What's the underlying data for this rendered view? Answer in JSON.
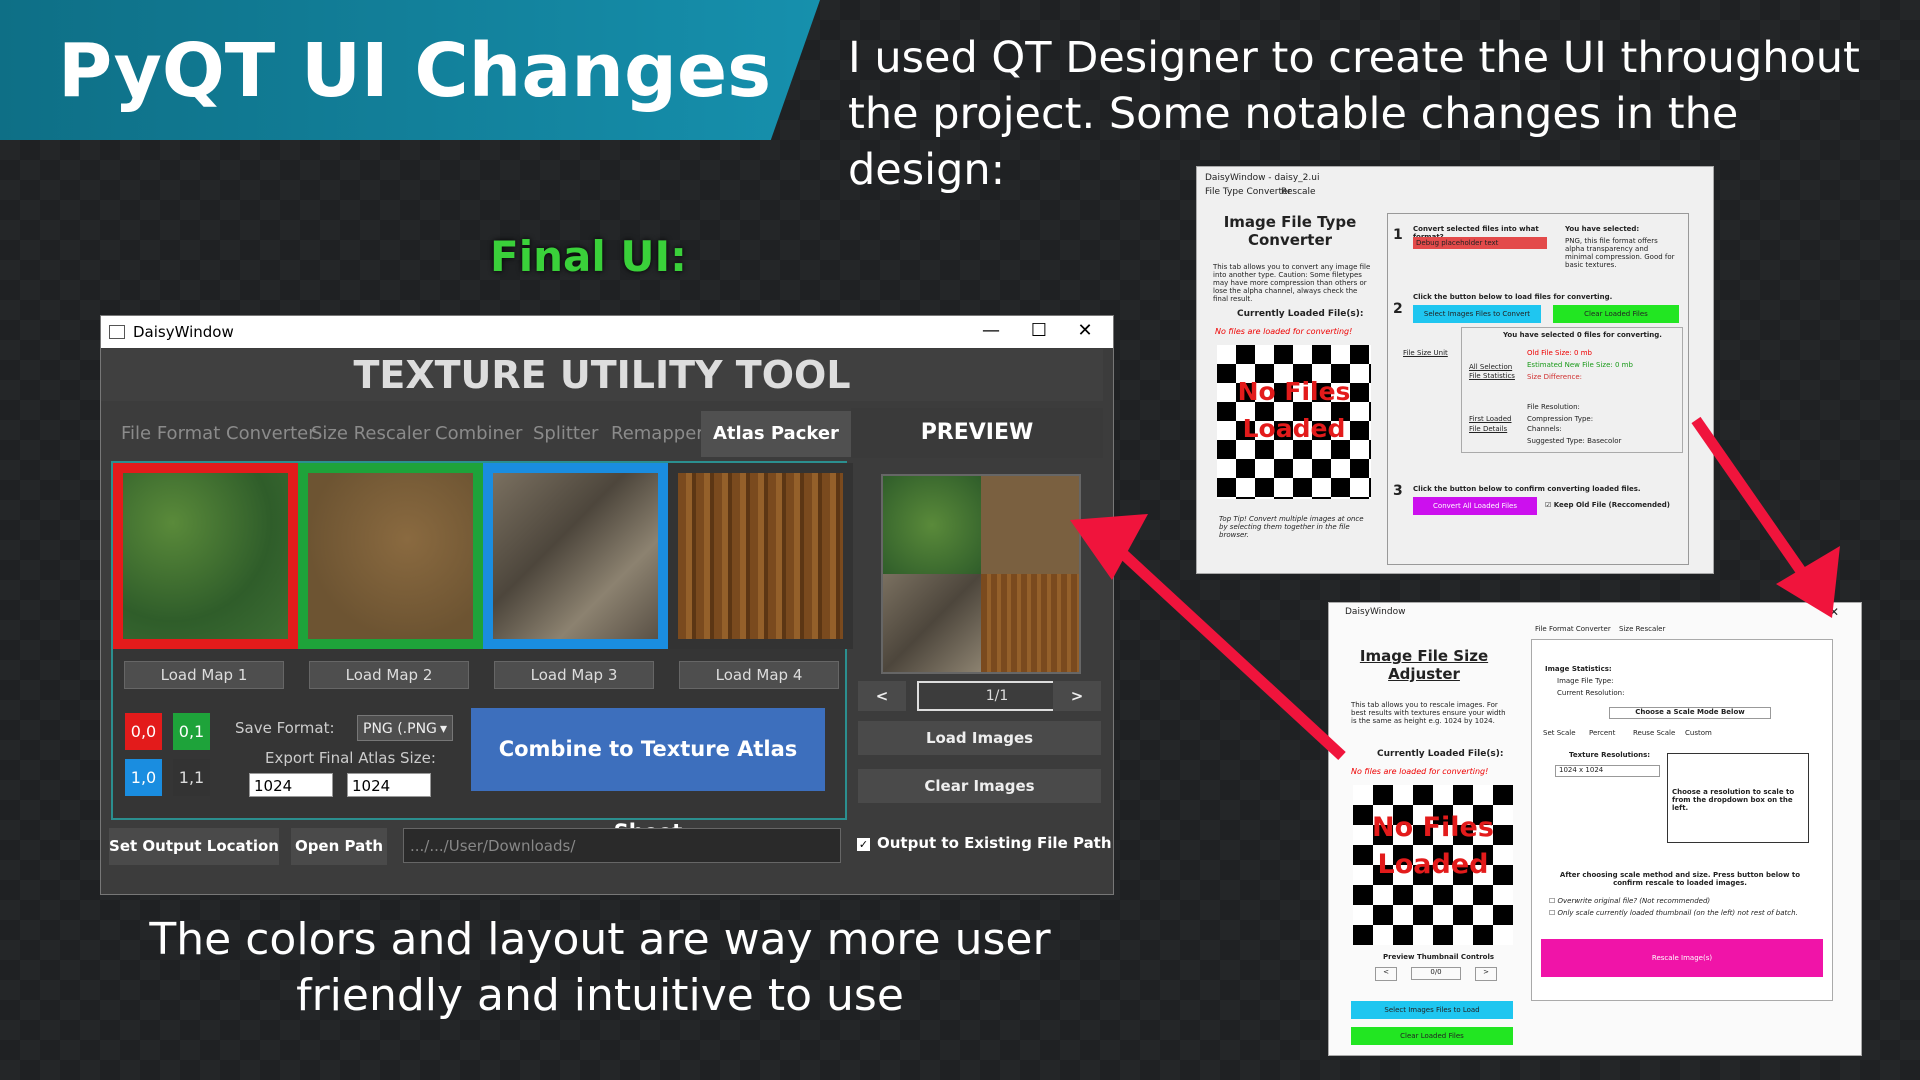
{
  "banner": {
    "title": "PyQT UI Changes"
  },
  "intro": "I used QT Designer to create the UI throughout the project. Some notable changes in the design:",
  "final_label": "Final UI:",
  "bottom_text": "The colors and layout are way more user friendly and intuitive to use",
  "main_window": {
    "title": "DaisyWindow",
    "app_title": "TEXTURE UTILITY TOOL",
    "tabs": [
      "File Format Converter",
      "Size Rescaler",
      "Combiner",
      "Splitter",
      "Remapper",
      "Atlas Packer"
    ],
    "active_tab": "Atlas Packer",
    "load_buttons": [
      "Load Map 1",
      "Load Map 2",
      "Load Map 3",
      "Load Map 4"
    ],
    "tile_colors": [
      "#e31b1b",
      "#1ea33a",
      "#1a8de0",
      "#333333"
    ],
    "coord_buttons": [
      "0,0",
      "0,1",
      "1,0",
      "1,1"
    ],
    "save_format_label": "Save Format:",
    "save_format_value": "PNG (.PNG",
    "export_size_label": "Export Final Atlas Size:",
    "width_value": "1024",
    "height_value": "1024",
    "combine_button": "Combine to Texture Atlas Sheet",
    "preview_title": "PREVIEW",
    "prev_label": "<",
    "next_label": ">",
    "page_indicator": "1/1",
    "load_images": "Load Images",
    "clear_images": "Clear Images",
    "set_output": "Set Output Location",
    "open_path": "Open Path",
    "path_value": ".../.../User/Downloads/",
    "output_existing": "Output to Existing File Path"
  },
  "old_window_1": {
    "title": "DaisyWindow - daisy_2.ui",
    "tabs": [
      "File Type Converter",
      "Rescale"
    ],
    "heading": "Image File Type Converter",
    "desc": "This tab allows you to convert any image file into another type. Caution: Some filetypes may have more compression than others or lose the alpha channel, always check the final result.",
    "loaded_label": "Currently Loaded File(s):",
    "no_files": "No files are loaded for converting!",
    "placeholder_text": "No Files Loaded",
    "tip": "Top Tip! Convert multiple images at once by selecting them together in the file browser.",
    "step1": "Convert selected files into what format?",
    "dropdown": "Debug placeholder text",
    "selected_label": "You have selected:",
    "selected_desc": "PNG, this file format offers alpha transparency and minimal compression. Good for basic textures.",
    "step2": "Click the button below to load files for converting.",
    "select_btn": "Select Images Files to Convert",
    "clear_btn": "Clear Loaded Files",
    "selected_count": "You have selected 0 files for converting.",
    "size_unit": "File Size Unit",
    "old_size": "Old File Size: 0 mb",
    "new_size": "Estimated New File Size: 0 mb",
    "size_diff": "Size Difference:",
    "all_selection": "All Selection",
    "file_stats": "File Statistics",
    "first_loaded": "First Loaded",
    "file_details": "File Details",
    "resolution": "File Resolution:",
    "compression": "Compression Type:",
    "channels": "Channels:",
    "suggested": "Suggested Type: Basecolor",
    "step3": "Click the button below to confirm converting loaded files.",
    "convert_btn": "Convert All Loaded Files",
    "keep_old": "Keep Old File (Reccomended)"
  },
  "old_window_2": {
    "title": "DaisyWindow",
    "heading": "Image File Size Adjuster",
    "desc": "This tab allows you to rescale images. For best results with textures ensure your width is the same as height e.g. 1024 by 1024.",
    "loaded_label": "Currently Loaded File(s):",
    "no_files": "No files are loaded for converting!",
    "placeholder_text": "No Files Loaded",
    "thumb_controls": "Preview Thumbnail Controls",
    "counter": "0/0",
    "select_btn": "Select Images Files to Load",
    "clear_btn": "Clear Loaded Files",
    "tabs": [
      "File Format Converter",
      "Size Rescaler"
    ],
    "image_stats": "Image Statistics:",
    "file_type": "Image File Type:",
    "current_res": "Current Resolution:",
    "scale_mode": "Choose a Scale Mode Below",
    "mode_tabs": [
      "Set Scale",
      "Percent",
      "Reuse Scale",
      "Custom"
    ],
    "texture_res": "Texture Resolutions:",
    "res_value": "1024 x 1024",
    "res_hint": "Choose a resolution to scale to from the dropdown box on the left.",
    "after_text": "After choosing scale method and size. Press button below to confirm rescale to loaded images.",
    "overwrite": "Overwrite original file? (Not recommended)",
    "only_scale": "Only scale currently loaded thumbnail (on the left) not rest of batch.",
    "rescale_btn": "Rescale Image(s)"
  }
}
